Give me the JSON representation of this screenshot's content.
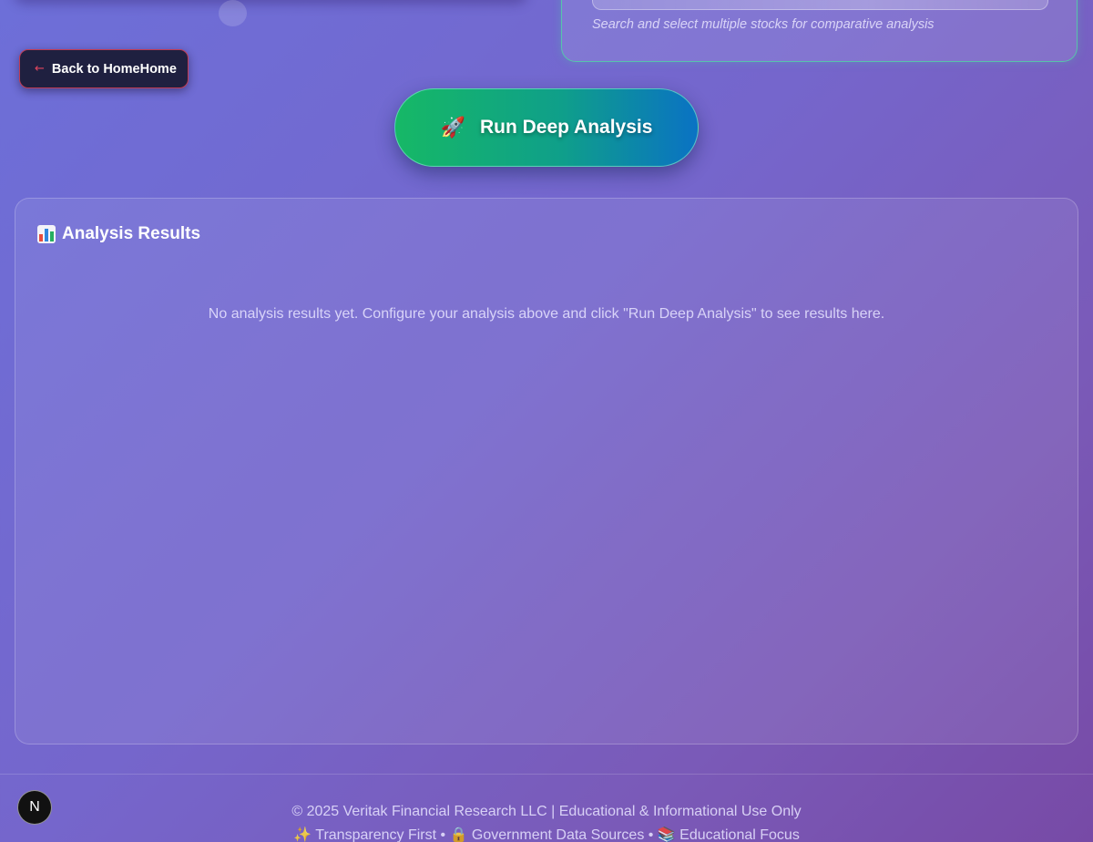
{
  "selector": {
    "hint": "Search and select multiple stocks for comparative analysis"
  },
  "nav": {
    "back_icon": "arrow-left-icon",
    "back_label": "Back to HomeHome"
  },
  "actions": {
    "run_icon": "rocket-icon",
    "run_emoji": "🚀",
    "run_label": "Run Deep Analysis"
  },
  "results": {
    "title_icon": "bar-chart-icon",
    "title": "Analysis Results",
    "empty_message": "No analysis results yet. Configure your analysis above and click \"Run Deep Analysis\" to see results here."
  },
  "footer": {
    "line1": "© 2025 Veritak Financial Research LLC | Educational & Informational Use Only",
    "line2": "✨ Transparency First • 🔒 Government Data Sources • 📚 Educational Focus"
  },
  "dev_badge": {
    "icon": "nextjs-icon",
    "label": "N"
  },
  "colors": {
    "background_start": "#6d6fd8",
    "background_end": "#774aa6",
    "run_gradient_start": "#16b866",
    "run_gradient_end": "#0a72c4",
    "back_border": "#c13c54",
    "back_bg": "#1f2040",
    "selector_border": "#4adea0"
  }
}
